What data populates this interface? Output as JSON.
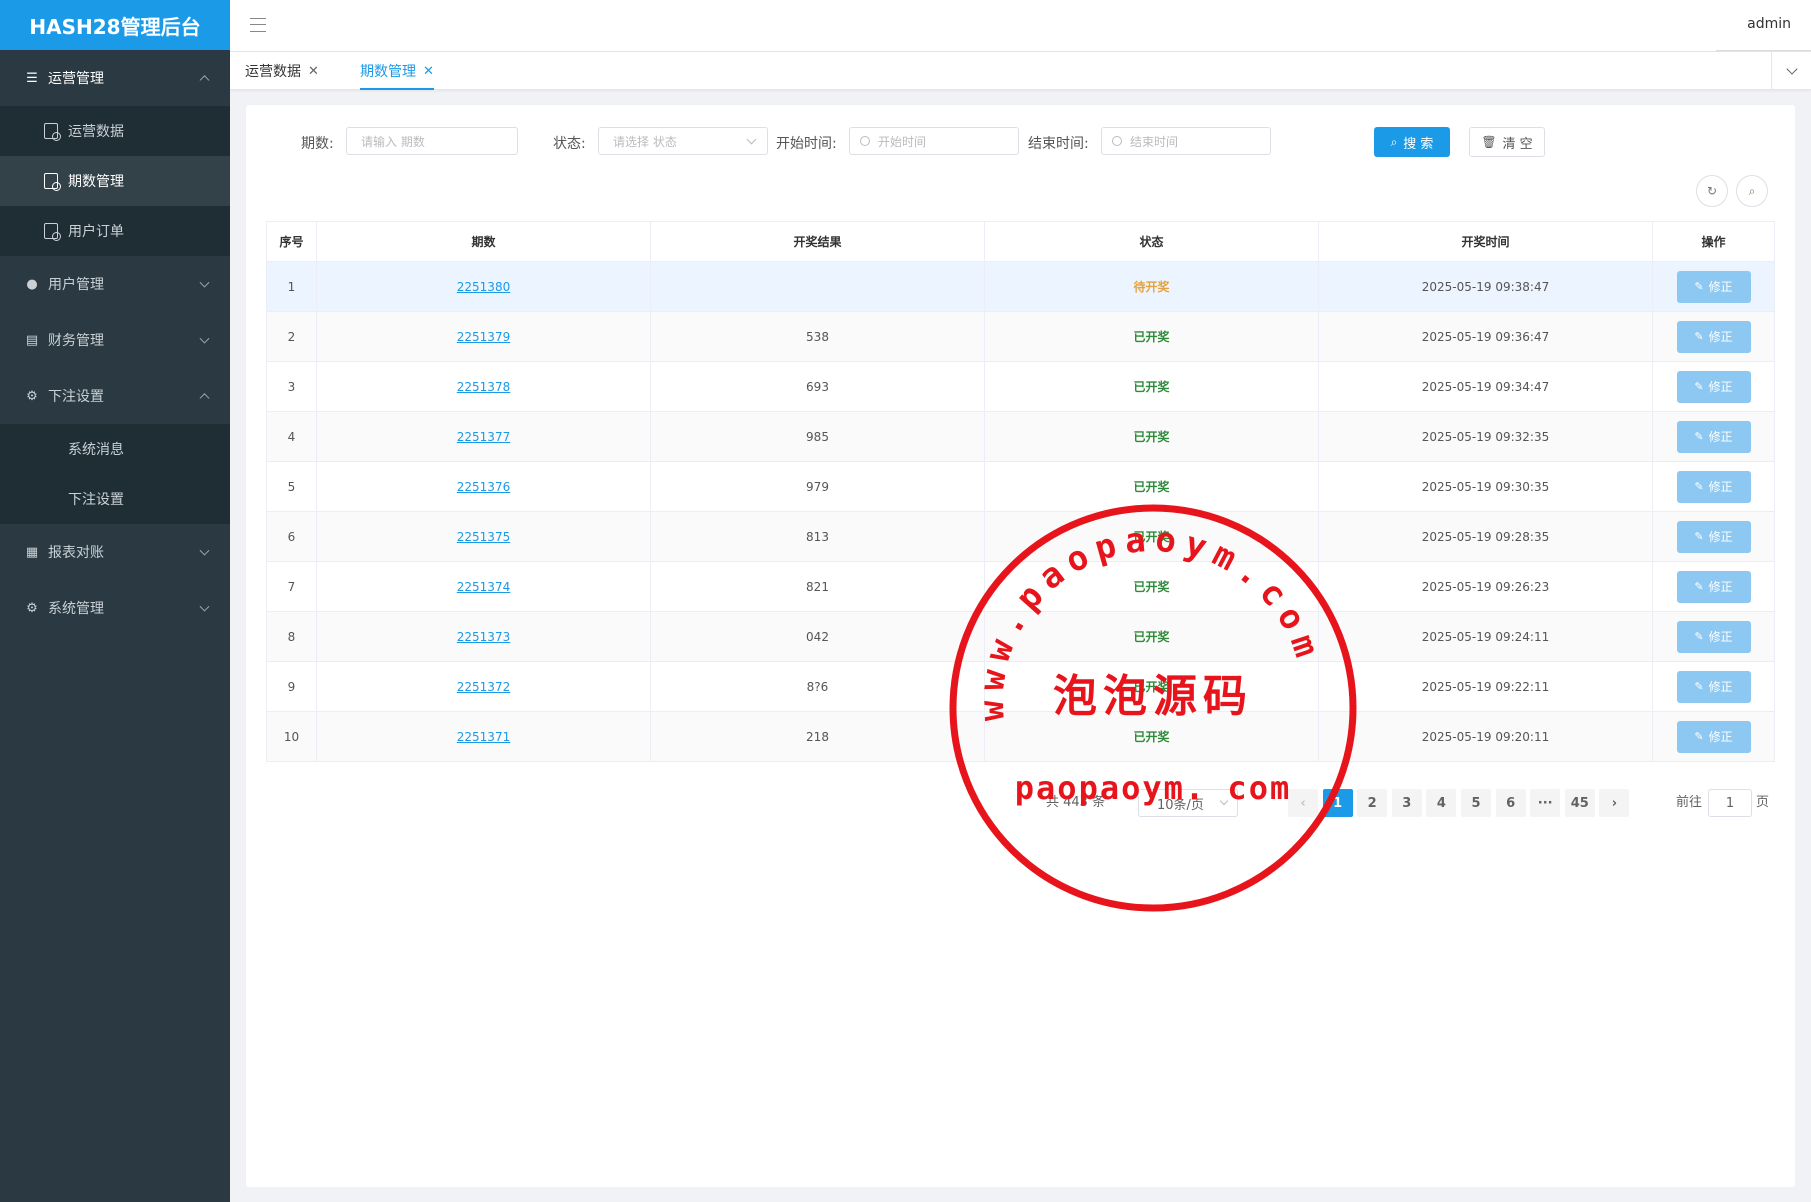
{
  "app": {
    "title": "HASH28管理后台",
    "user": "admin"
  },
  "sidebar": {
    "groups": [
      {
        "label": "运营管理",
        "icon": "list-icon",
        "open": true,
        "items": [
          {
            "label": "运营数据",
            "active": false
          },
          {
            "label": "期数管理",
            "active": true
          },
          {
            "label": "用户订单",
            "active": false
          }
        ]
      },
      {
        "label": "用户管理",
        "icon": "user-icon",
        "open": false
      },
      {
        "label": "财务管理",
        "icon": "document-icon",
        "open": false
      },
      {
        "label": "下注设置",
        "icon": "gear-icon",
        "open": true,
        "items": [
          {
            "label": "系统消息"
          },
          {
            "label": "下注设置"
          }
        ]
      },
      {
        "label": "报表对账",
        "icon": "report-icon",
        "open": false
      },
      {
        "label": "系统管理",
        "icon": "gear-icon",
        "open": false
      }
    ]
  },
  "tabs": [
    {
      "label": "运营数据",
      "active": false
    },
    {
      "label": "期数管理",
      "active": true
    }
  ],
  "filters": {
    "period_label": "期数:",
    "period_placeholder": "请输入 期数",
    "status_label": "状态:",
    "status_placeholder": "请选择 状态",
    "start_label": "开始时间:",
    "start_placeholder": "开始时间",
    "end_label": "结束时间:",
    "end_placeholder": "结束时间",
    "search_label": "搜 索",
    "clear_label": "清 空"
  },
  "table": {
    "headers": [
      "序号",
      "期数",
      "开奖结果",
      "状态",
      "开奖时间",
      "操作"
    ],
    "action_label": "修正",
    "rows": [
      {
        "no": "1",
        "period": "2251380",
        "result": "",
        "status": "待开奖",
        "time": "2025-05-19 09:38:47"
      },
      {
        "no": "2",
        "period": "2251379",
        "result": "538",
        "status": "已开奖",
        "time": "2025-05-19 09:36:47"
      },
      {
        "no": "3",
        "period": "2251378",
        "result": "693",
        "status": "已开奖",
        "time": "2025-05-19 09:34:47"
      },
      {
        "no": "4",
        "period": "2251377",
        "result": "985",
        "status": "已开奖",
        "time": "2025-05-19 09:32:35"
      },
      {
        "no": "5",
        "period": "2251376",
        "result": "979",
        "status": "已开奖",
        "time": "2025-05-19 09:30:35"
      },
      {
        "no": "6",
        "period": "2251375",
        "result": "813",
        "status": "已开奖",
        "time": "2025-05-19 09:28:35"
      },
      {
        "no": "7",
        "period": "2251374",
        "result": "821",
        "status": "已开奖",
        "time": "2025-05-19 09:26:23"
      },
      {
        "no": "8",
        "period": "2251373",
        "result": "042",
        "status": "已开奖",
        "time": "2025-05-19 09:24:11"
      },
      {
        "no": "9",
        "period": "2251372",
        "result": "8?6",
        "status": "已开奖",
        "time": "2025-05-19 09:22:11"
      },
      {
        "no": "10",
        "period": "2251371",
        "result": "218",
        "status": "已开奖",
        "time": "2025-05-19 09:20:11"
      }
    ]
  },
  "pagination": {
    "total_text": "共 443 条",
    "page_size": "10条/页",
    "pages": [
      "1",
      "2",
      "3",
      "4",
      "5",
      "6",
      "···",
      "45"
    ],
    "current": "1",
    "goto_label": "前往",
    "goto_value": "1",
    "page_suffix": "页"
  },
  "watermark": {
    "arc_text": "www.paopaoym.com",
    "center_text": "泡泡源码",
    "bottom_text": "paopaoym. com",
    "color": "#e8141b"
  },
  "colors": {
    "brand": "#1b9ae8",
    "sidebar": "#2b3a42",
    "pending": "#e6a23c",
    "done": "#2e8b3a"
  }
}
